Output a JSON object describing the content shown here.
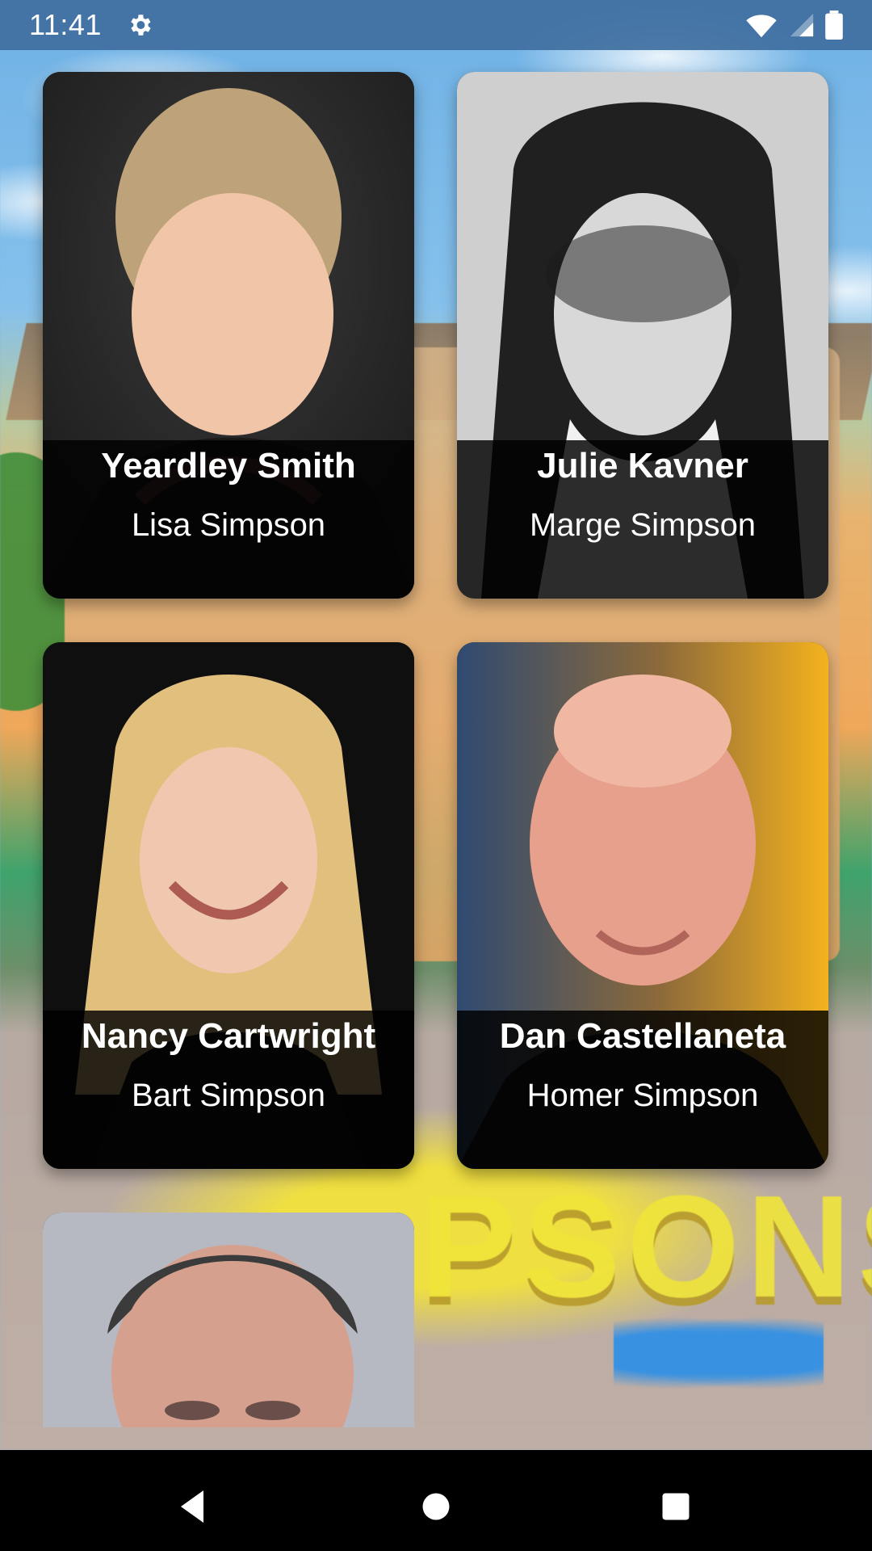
{
  "status_bar": {
    "time": "11:41",
    "icons": [
      "gear-icon",
      "wifi-icon",
      "signal-icon",
      "battery-icon"
    ]
  },
  "cast": [
    {
      "name": "Yeardley Smith",
      "role": "Lisa Simpson"
    },
    {
      "name": "Julie Kavner",
      "role": "Marge Simpson"
    },
    {
      "name": "Nancy Cartwright",
      "role": "Bart Simpson"
    },
    {
      "name": "Dan Castellaneta",
      "role": "Homer Simpson"
    },
    {
      "name": "",
      "role": ""
    }
  ],
  "background": {
    "logo_text": "PSONS"
  },
  "nav_bar": {
    "icons": [
      "back-icon",
      "home-icon",
      "recents-icon"
    ]
  },
  "colors": {
    "status_bar": "#3f6fa0",
    "caption_overlay": "#000000",
    "nav_bar": "#000000"
  }
}
